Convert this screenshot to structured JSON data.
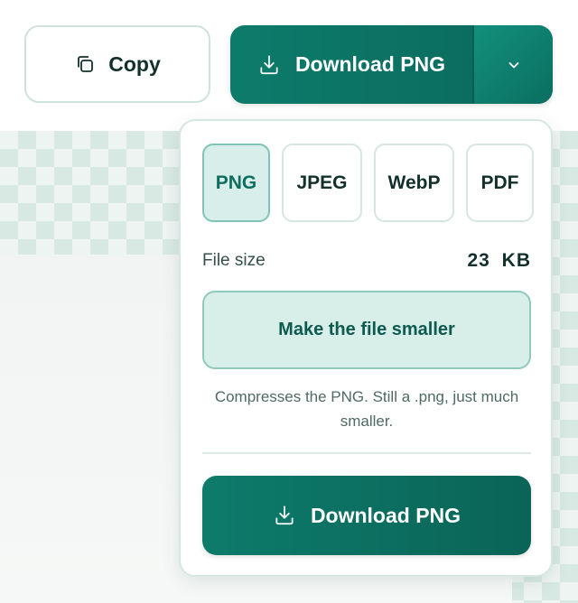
{
  "toolbar": {
    "copy_label": "Copy",
    "download_label": "Download PNG"
  },
  "export_panel": {
    "formats": [
      {
        "label": "PNG",
        "selected": true
      },
      {
        "label": "JPEG",
        "selected": false
      },
      {
        "label": "WebP",
        "selected": false
      },
      {
        "label": "PDF",
        "selected": false
      }
    ],
    "file_size_label": "File size",
    "file_size_value": "23 KB",
    "compress_button_label": "Make the file smaller",
    "compress_note": "Compresses the PNG. Still a .png, just much smaller.",
    "download_button_label": "Download PNG"
  },
  "icons": {
    "copy": "copy-icon",
    "download": "download-icon",
    "caret": "chevron-down-icon"
  },
  "colors": {
    "accent": "#0d7b6b",
    "accent_light": "#d7eeea",
    "text": "#12302c"
  }
}
